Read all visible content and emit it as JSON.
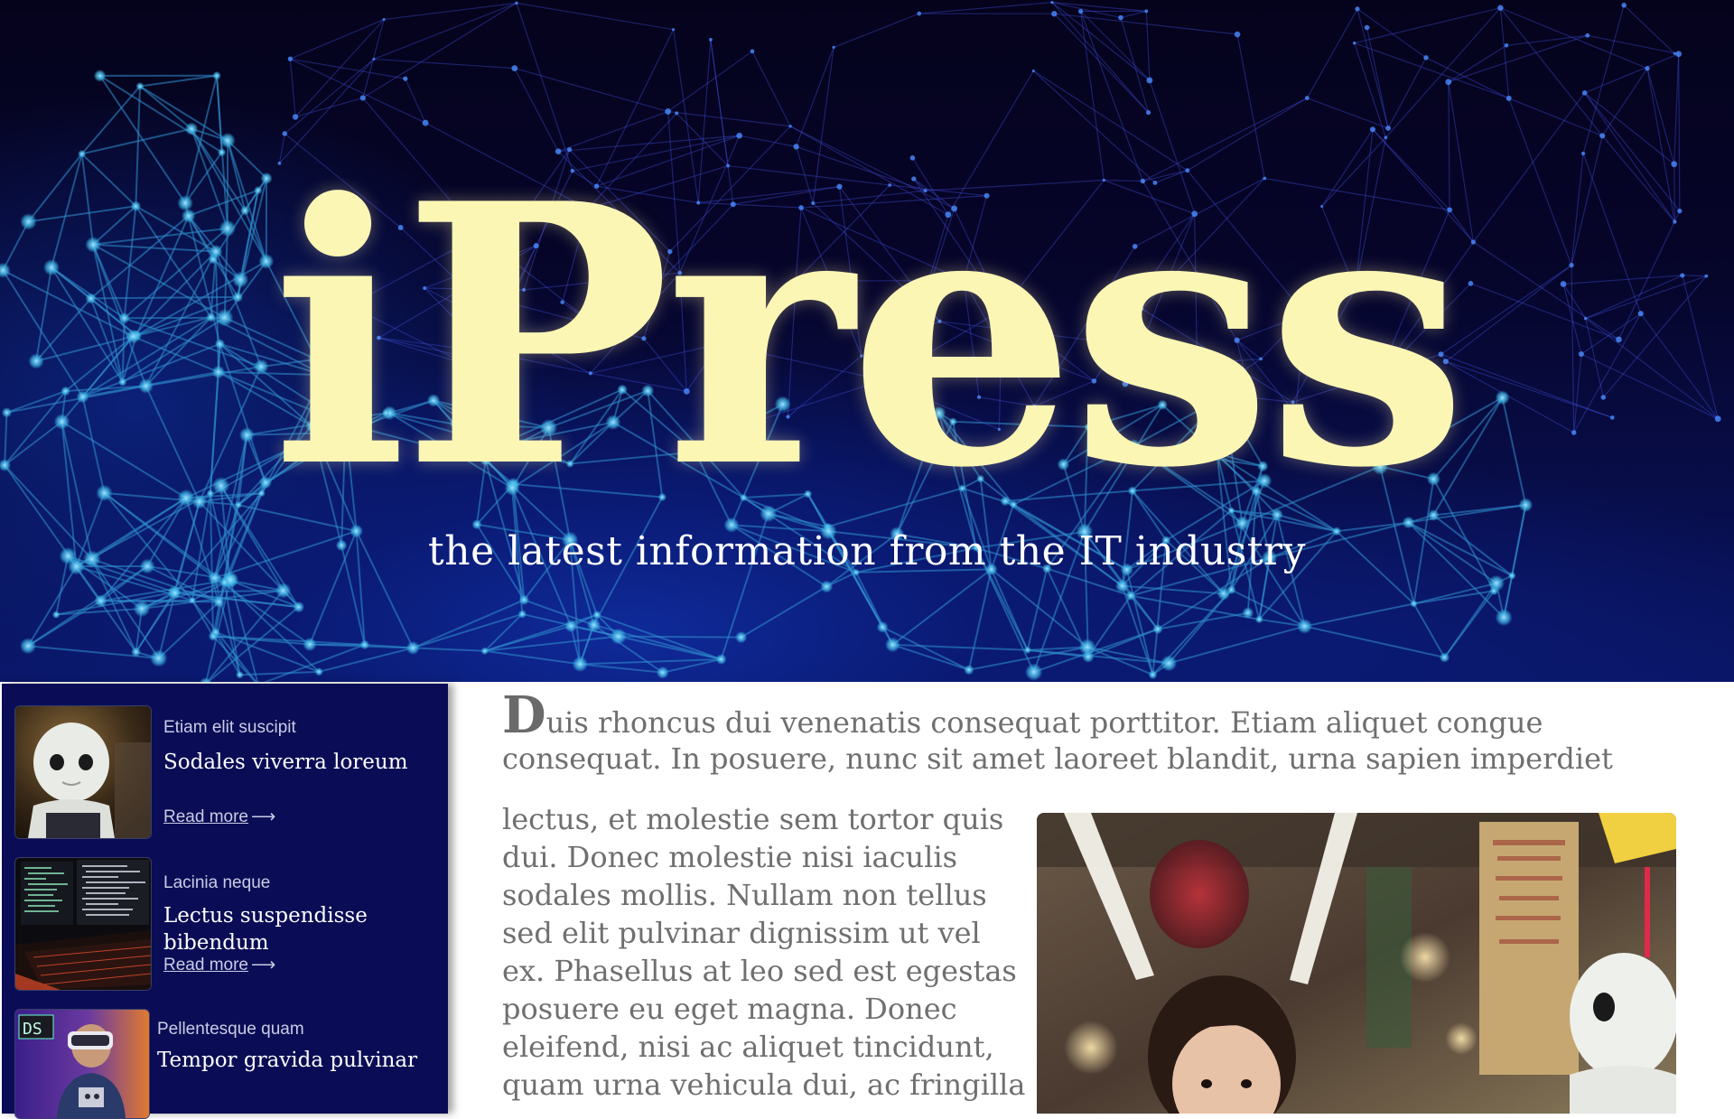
{
  "hero": {
    "title": "iPress",
    "subtitle": "the latest information from the IT industry"
  },
  "sidebar": {
    "cards": [
      {
        "category": "Etiam elit suscipit",
        "title": "Sodales viverra loreum",
        "read_more": "Read more",
        "thumbnail_icon": "robot-pepper-photo"
      },
      {
        "category": "Lacinia neque",
        "title": "Lectus suspendisse bibendum",
        "read_more": "Read more",
        "thumbnail_icon": "code-monitor-keyboard-photo"
      },
      {
        "category": "Pellentesque quam",
        "title": "Tempor gravida pulvinar",
        "thumbnail_icon": "vr-headset-person-photo"
      }
    ]
  },
  "article": {
    "dropcap": "D",
    "lead_line_1": "uis rhoncus dui venenatis consequat porttitor. Etiam aliquet congue",
    "lead_line_2": "consequat. In posuere, nunc sit amet laoreet blandit, urna sapien imperdiet",
    "body_lines": [
      "lectus, et molestie sem tortor quis",
      "dui. Donec molestie nisi iaculis",
      "sodales mollis. Nullam non tellus",
      "sed elit pulvinar dignissim ut vel",
      "ex. Phasellus at leo sed est egestas",
      "posuere eu eget magna. Donec",
      "eleifend, nisi ac aliquet tincidunt,",
      "quam urna vehicula dui, ac fringilla"
    ],
    "photo_icon": "child-with-robot-photo"
  },
  "colors": {
    "hero_bg": "#05031c",
    "hero_title": "#fbf6b4",
    "sidebar_bg": "#0a0d55",
    "body_text": "#6f6f6f"
  }
}
